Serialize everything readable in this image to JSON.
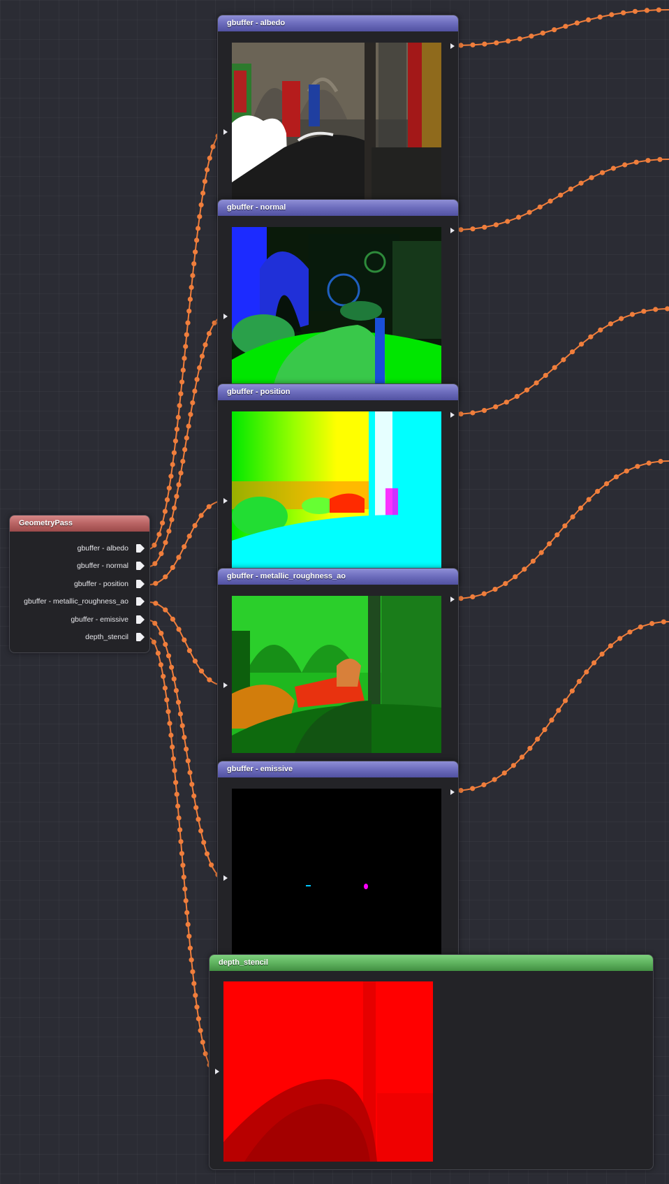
{
  "geometry_pass": {
    "title": "GeometryPass",
    "outputs": [
      "gbuffer - albedo",
      "gbuffer - normal",
      "gbuffer - position",
      "gbuffer - metallic_roughness_ao",
      "gbuffer - emissive",
      "depth_stencil"
    ]
  },
  "preview_nodes": [
    {
      "title": "gbuffer - albedo"
    },
    {
      "title": "gbuffer - normal"
    },
    {
      "title": "gbuffer - position"
    },
    {
      "title": "gbuffer - metallic_roughness_ao"
    },
    {
      "title": "gbuffer - emissive"
    },
    {
      "title": "depth_stencil"
    }
  ],
  "colors": {
    "wire": "#f07e3c",
    "preview_header": "#6f6fbf",
    "source_header": "#b96464",
    "depth_header": "#5fb35f"
  }
}
